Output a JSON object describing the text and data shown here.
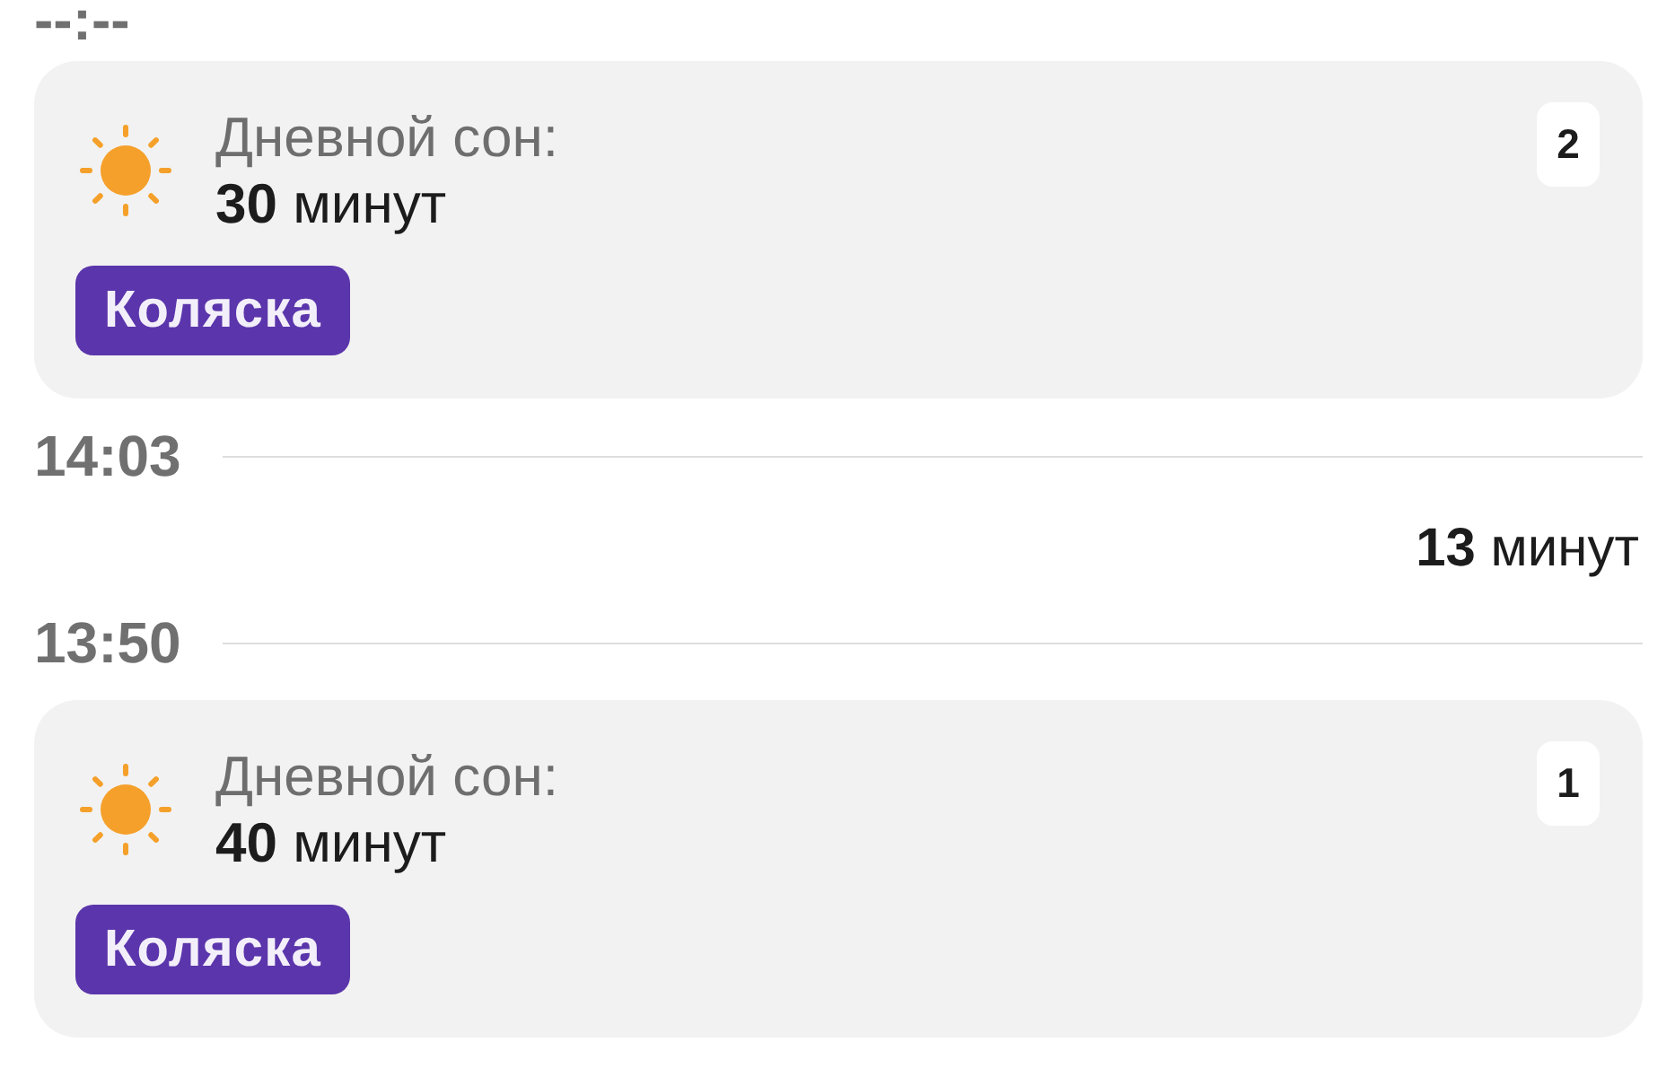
{
  "timeline": [
    {
      "kind": "time",
      "time": "--:--",
      "divider": false
    },
    {
      "kind": "sleep",
      "title": "Дневной сон:",
      "duration": "**30** минут",
      "tag": "Коляска",
      "number": "2"
    },
    {
      "kind": "time",
      "time": "14:03",
      "divider": true
    },
    {
      "kind": "interval",
      "duration": "**13** минут"
    },
    {
      "kind": "time",
      "time": "13:50",
      "divider": true
    },
    {
      "kind": "sleep",
      "title": "Дневной сон:",
      "duration": "**40** минут",
      "tag": "Коляска",
      "number": "1"
    }
  ]
}
